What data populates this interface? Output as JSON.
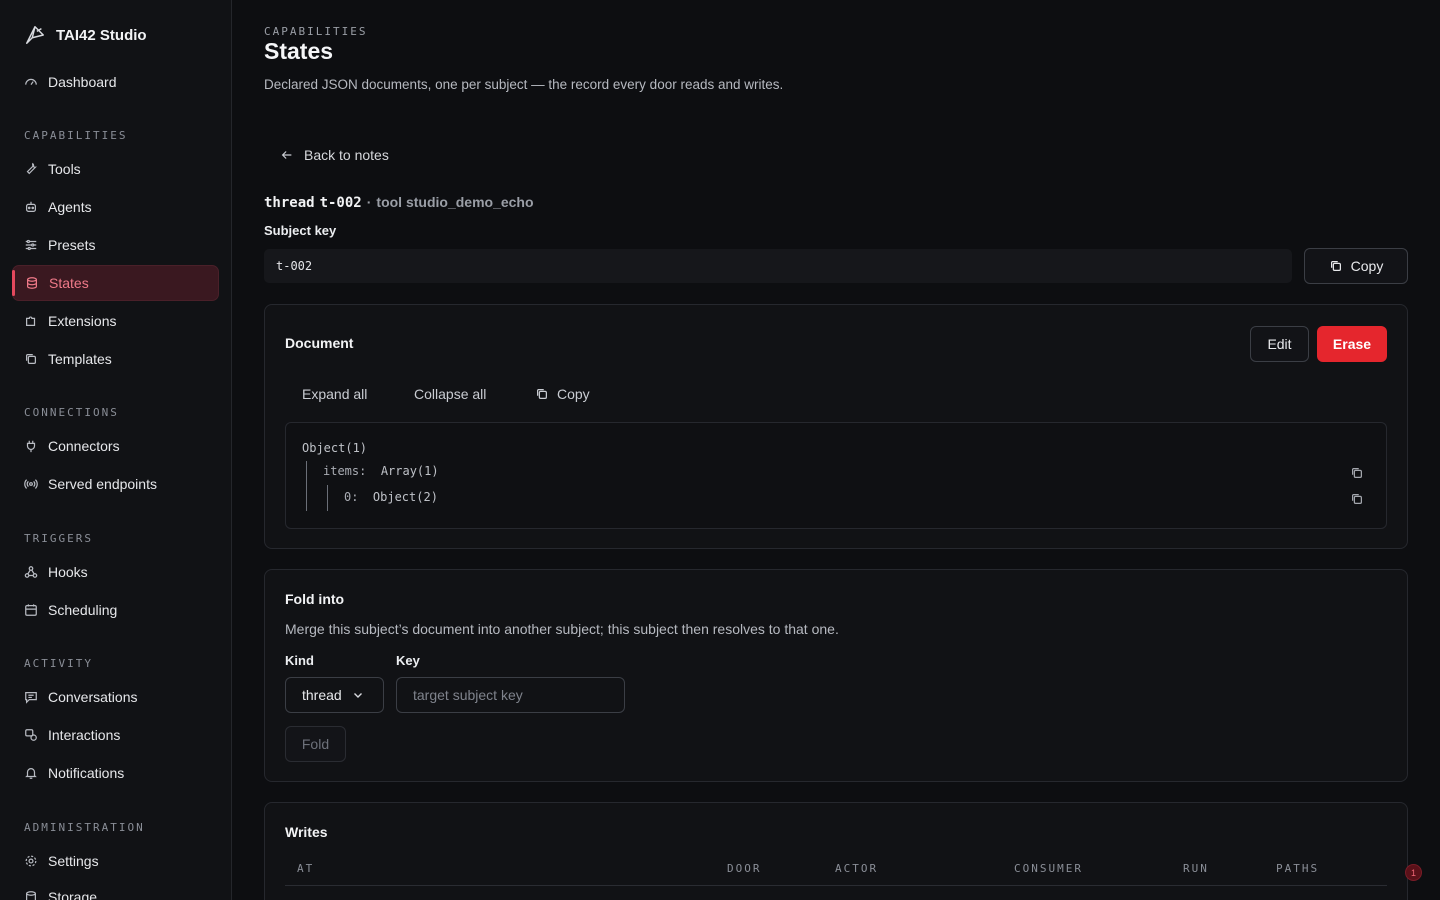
{
  "brand": {
    "name": "TAI42 Studio",
    "icon": "logo-icon"
  },
  "sidebar": {
    "top": [
      {
        "label": "Dashboard",
        "icon": "gauge-icon"
      }
    ],
    "sections": [
      {
        "label": "CAPABILITIES",
        "items": [
          {
            "label": "Tools",
            "icon": "wrench-icon"
          },
          {
            "label": "Agents",
            "icon": "bot-icon"
          },
          {
            "label": "Presets",
            "icon": "sliders-icon"
          },
          {
            "label": "States",
            "icon": "database-icon",
            "active": true
          },
          {
            "label": "Extensions",
            "icon": "puzzle-icon"
          },
          {
            "label": "Templates",
            "icon": "copy-icon"
          }
        ]
      },
      {
        "label": "CONNECTIONS",
        "items": [
          {
            "label": "Connectors",
            "icon": "plug-icon"
          },
          {
            "label": "Served endpoints",
            "icon": "radio-icon"
          }
        ]
      },
      {
        "label": "TRIGGERS",
        "items": [
          {
            "label": "Hooks",
            "icon": "webhook-icon"
          },
          {
            "label": "Scheduling",
            "icon": "calendar-icon"
          }
        ]
      },
      {
        "label": "ACTIVITY",
        "items": [
          {
            "label": "Conversations",
            "icon": "message-icon"
          },
          {
            "label": "Interactions",
            "icon": "interactions-icon"
          },
          {
            "label": "Notifications",
            "icon": "bell-icon"
          }
        ]
      },
      {
        "label": "ADMINISTRATION",
        "items": [
          {
            "label": "Settings",
            "icon": "gear-icon"
          },
          {
            "label": "Storage",
            "icon": "database-icon"
          }
        ]
      }
    ]
  },
  "header": {
    "eyebrow": "CAPABILITIES",
    "title": "States",
    "description": "Declared JSON documents, one per subject — the record every door reads and writes."
  },
  "back_label": "Back to notes",
  "subject": {
    "kind": "thread",
    "key": "t-002",
    "separator": "·",
    "tool_text": "tool studio_demo_echo",
    "key_label": "Subject key",
    "copy_label": "Copy"
  },
  "document": {
    "title": "Document",
    "edit_label": "Edit",
    "erase_label": "Erase",
    "expand_label": "Expand all",
    "collapse_label": "Collapse all",
    "copy_label": "Copy",
    "tree": {
      "root": "Object(1)",
      "items_key": "items:",
      "items_val": "Array(1)",
      "item0_key": "0:",
      "item0_val": "Object(2)"
    }
  },
  "fold": {
    "title": "Fold into",
    "description": "Merge this subject’s document into another subject; this subject then resolves to that one.",
    "kind_label": "Kind",
    "kind_value": "thread",
    "key_label": "Key",
    "key_placeholder": "target subject key",
    "fold_label": "Fold"
  },
  "writes": {
    "title": "Writes",
    "columns": [
      "AT",
      "DOOR",
      "ACTOR",
      "CONSUMER",
      "RUN",
      "PATHS"
    ]
  },
  "notification_badge": "1",
  "colors": {
    "accent": "#e5485d",
    "danger": "#e5262d",
    "background": "#0d0e11"
  }
}
